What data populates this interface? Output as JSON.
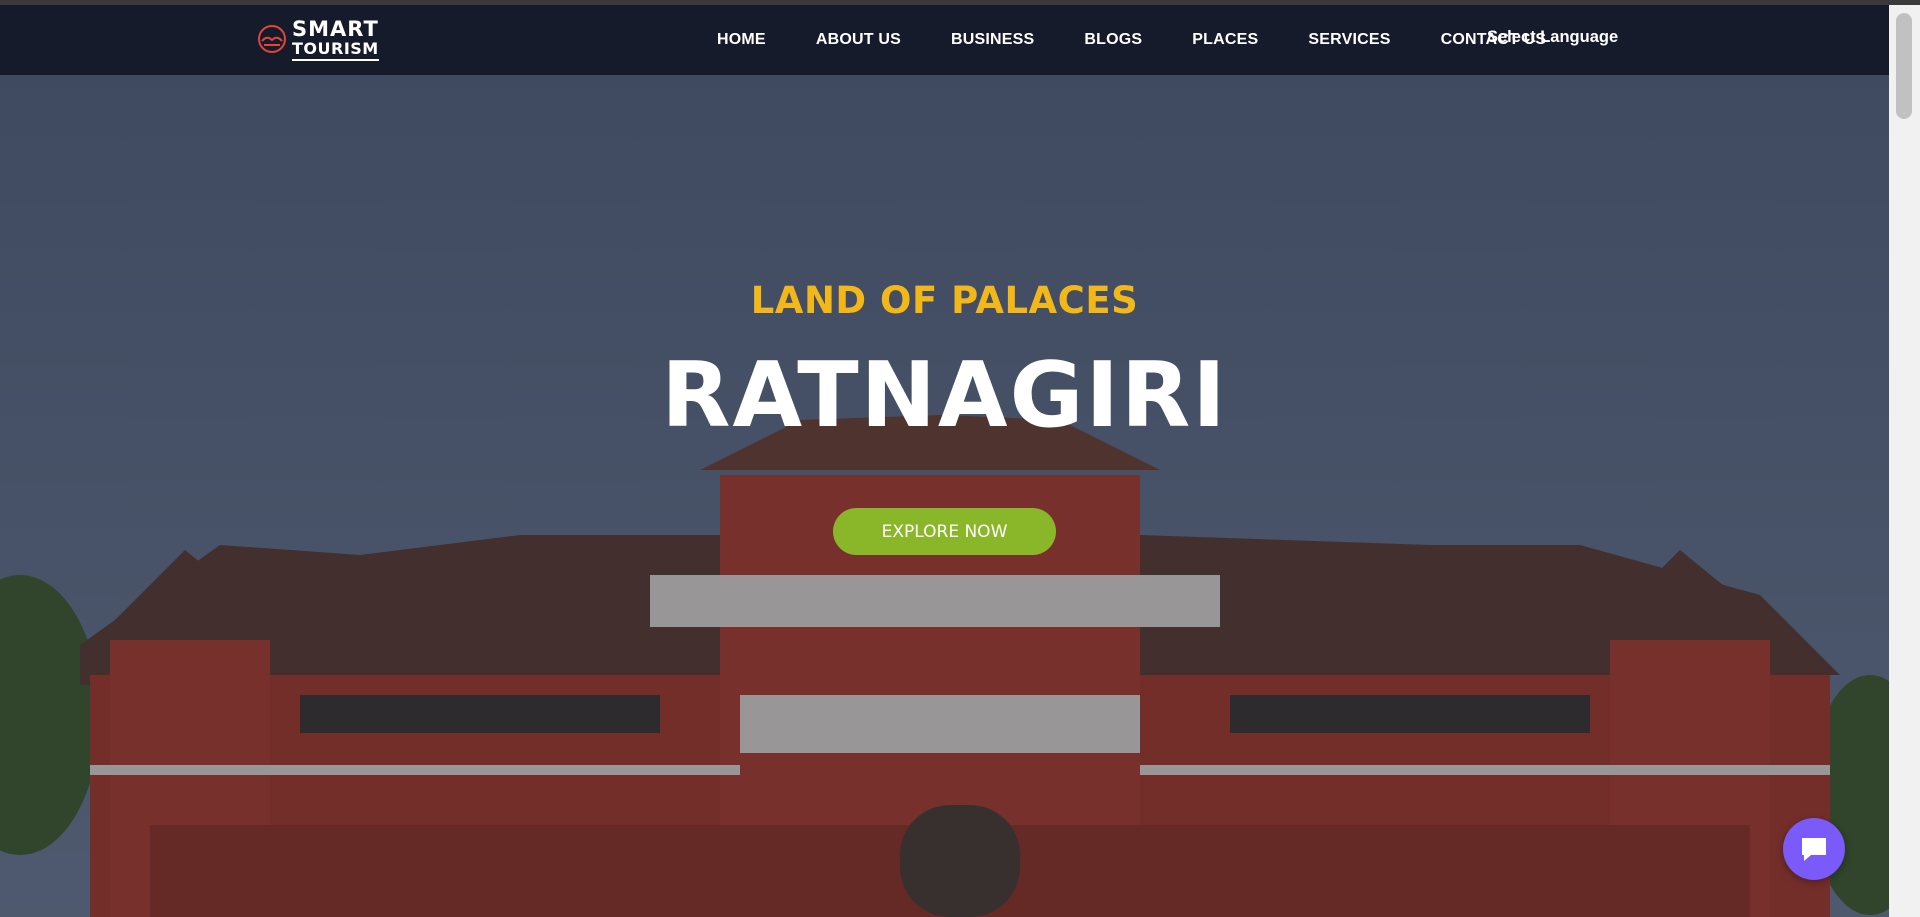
{
  "brand": {
    "name_line1": "SMART",
    "name_line2": "TOURISM",
    "logo_icon": "smart-tourism-logo-icon"
  },
  "nav": {
    "items": [
      {
        "label": "HOME"
      },
      {
        "label": "ABOUT US"
      },
      {
        "label": "BUSINESS"
      },
      {
        "label": "BLOGS"
      },
      {
        "label": "PLACES"
      },
      {
        "label": "SERVICES"
      },
      {
        "label": "CONTACT US"
      }
    ],
    "language_label": "Select Language"
  },
  "hero": {
    "subtitle": "LAND OF PALACES",
    "title": "RATNAGIRI",
    "cta_label": "EXPLORE NOW"
  },
  "chat": {
    "icon": "chat-bubble-icon"
  },
  "colors": {
    "navbar_bg": "#161b2c",
    "subtitle": "#f2b718",
    "cta_bg": "#8ab729",
    "chat_bg": "#7a5af8"
  }
}
